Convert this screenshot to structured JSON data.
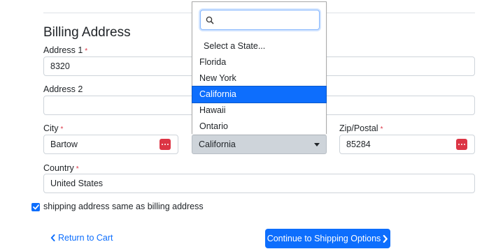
{
  "billing": {
    "title": "Billing Address",
    "address1": {
      "label": "Address 1",
      "required_mark": "*",
      "value": "8320"
    },
    "address2": {
      "label": "Address 2",
      "value": ""
    },
    "city": {
      "label": "City",
      "required_mark": "*",
      "value": "Bartow"
    },
    "state": {
      "value": "California"
    },
    "zip": {
      "label": "Zip/Postal",
      "required_mark": "*",
      "value": "85284"
    },
    "country": {
      "label": "Country",
      "required_mark": "*",
      "value": "United States"
    }
  },
  "state_dropdown": {
    "search_value": "",
    "options": [
      "Select a State...",
      "Florida",
      "New York",
      "California",
      "Hawaii",
      "Ontario"
    ],
    "selected": "California"
  },
  "same_address": {
    "checked": true,
    "label": "shipping address same as billing address"
  },
  "actions": {
    "return_label": "Return to Cart",
    "continue_label": "Continue to Shipping Options"
  },
  "colors": {
    "accent": "#0d6efd",
    "required": "#dc3545",
    "ext_button": "#dc3545"
  }
}
